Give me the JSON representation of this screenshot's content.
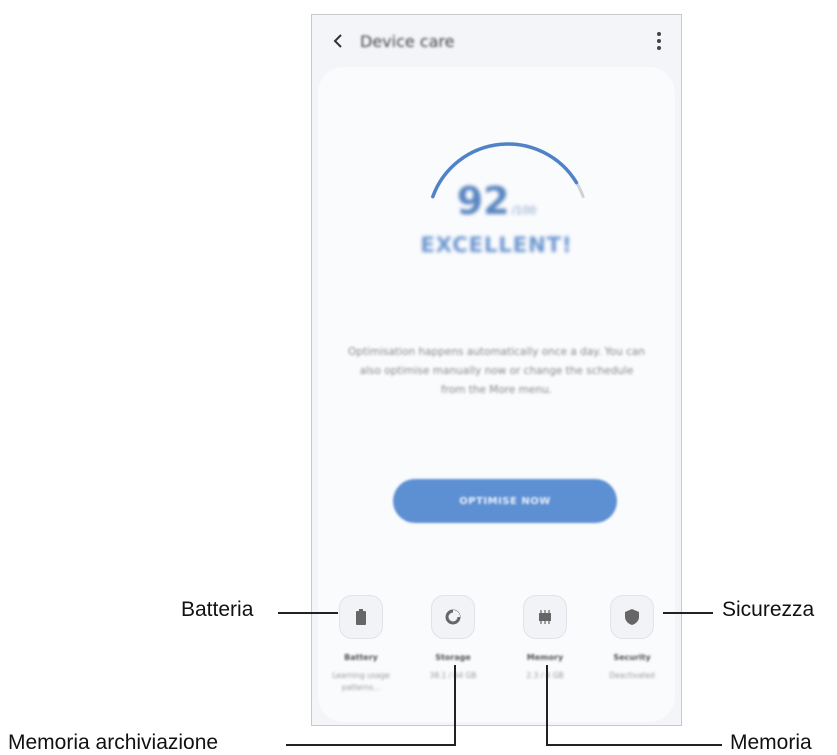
{
  "app_bar": {
    "title": "Device care",
    "back_icon": "chevron-left-icon",
    "more_icon": "more-vert-icon"
  },
  "score": {
    "value": "92",
    "max": "/100",
    "status": "EXCELLENT!",
    "gauge_fraction": 0.92
  },
  "description": "Optimisation happens automatically once a day. You can also optimise manually now or change the schedule from the More menu.",
  "optimise_button": "OPTIMISE NOW",
  "tiles": [
    {
      "name": "Battery",
      "sub": "Learning usage patterns...",
      "icon": "battery-icon"
    },
    {
      "name": "Storage",
      "sub": "38.1 / 64 GB",
      "icon": "storage-pie-icon"
    },
    {
      "name": "Memory",
      "sub": "2.3 / 4 GB",
      "icon": "memory-chip-icon"
    },
    {
      "name": "Security",
      "sub": "Deactivated",
      "icon": "shield-icon"
    }
  ],
  "callouts": {
    "battery": "Batteria",
    "storage": "Memoria archiviazione",
    "memory": "Memoria",
    "security": "Sicurezza"
  },
  "colors": {
    "accent": "#5d8fd3",
    "gauge_track": "#cfd3d9",
    "text_blue": "#6a95cf"
  }
}
